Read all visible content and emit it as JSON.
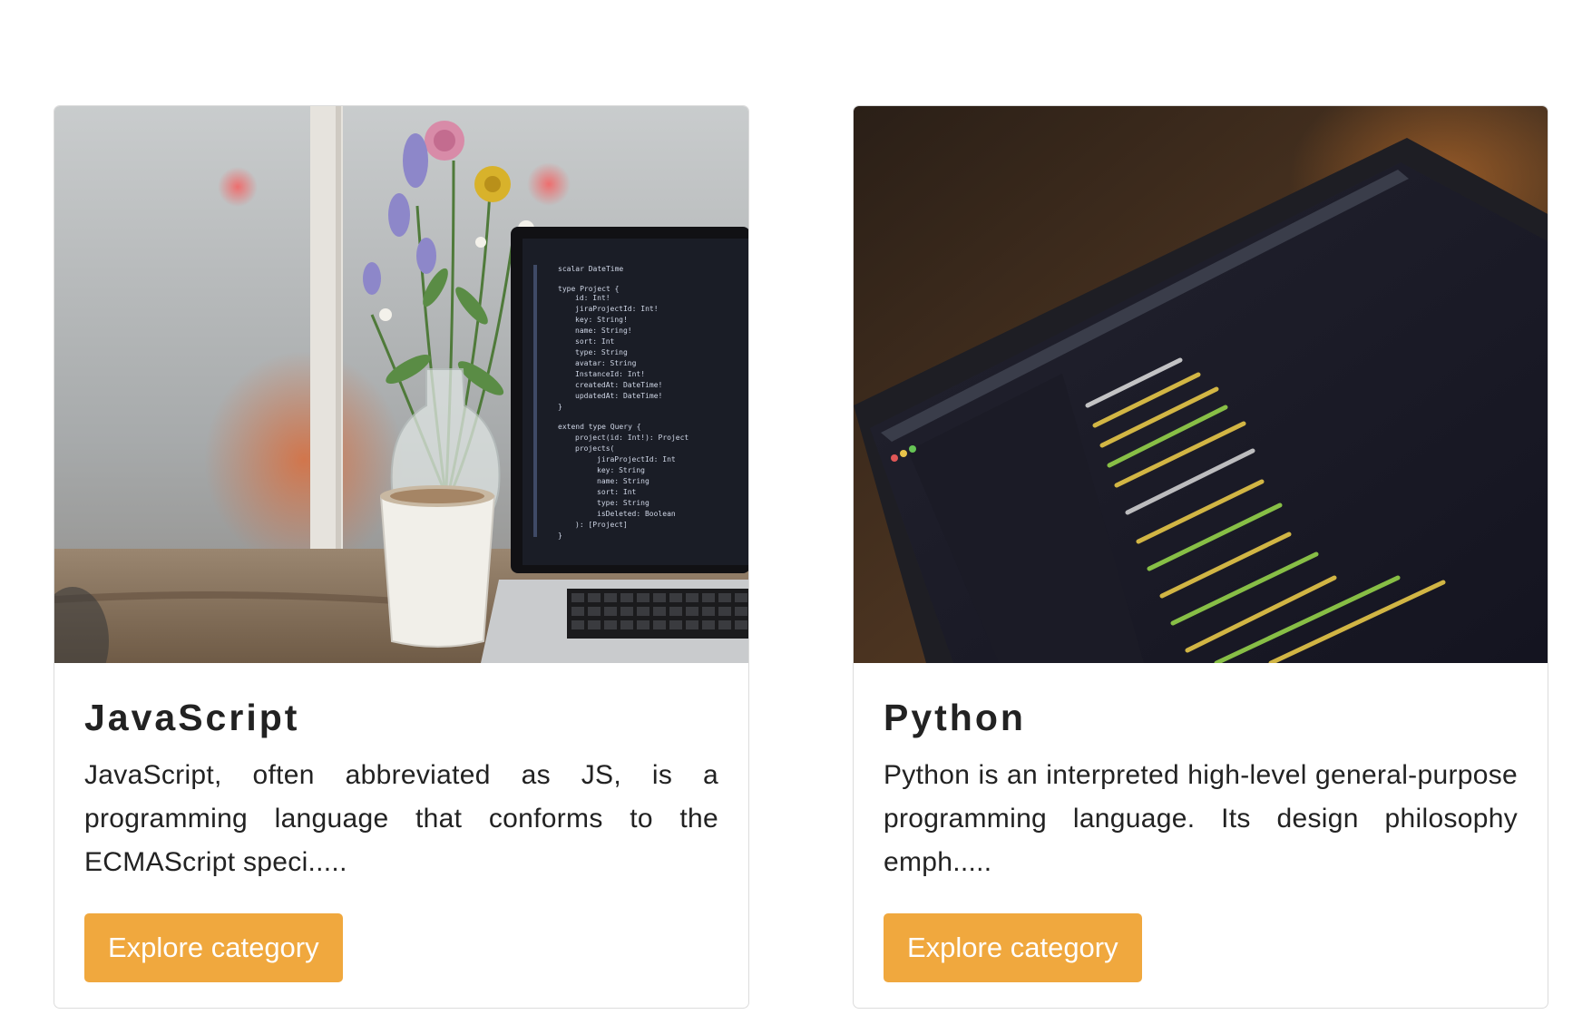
{
  "cards": [
    {
      "title": "JavaScript",
      "description": "JavaScript, often abbreviated as JS, is a programming language that conforms to the ECMAScript speci.....",
      "button_label": "Explore category",
      "image_alt": "laptop-with-code-and-flowers"
    },
    {
      "title": "Python",
      "description": "Python is an interpreted high-level general-purpose programming language. Its design philosophy emph.....",
      "button_label": "Explore category",
      "image_alt": "laptop-screen-with-code"
    }
  ],
  "colors": {
    "button": "#f0a83e",
    "card_border": "#dcdcdc",
    "text": "#222222"
  }
}
